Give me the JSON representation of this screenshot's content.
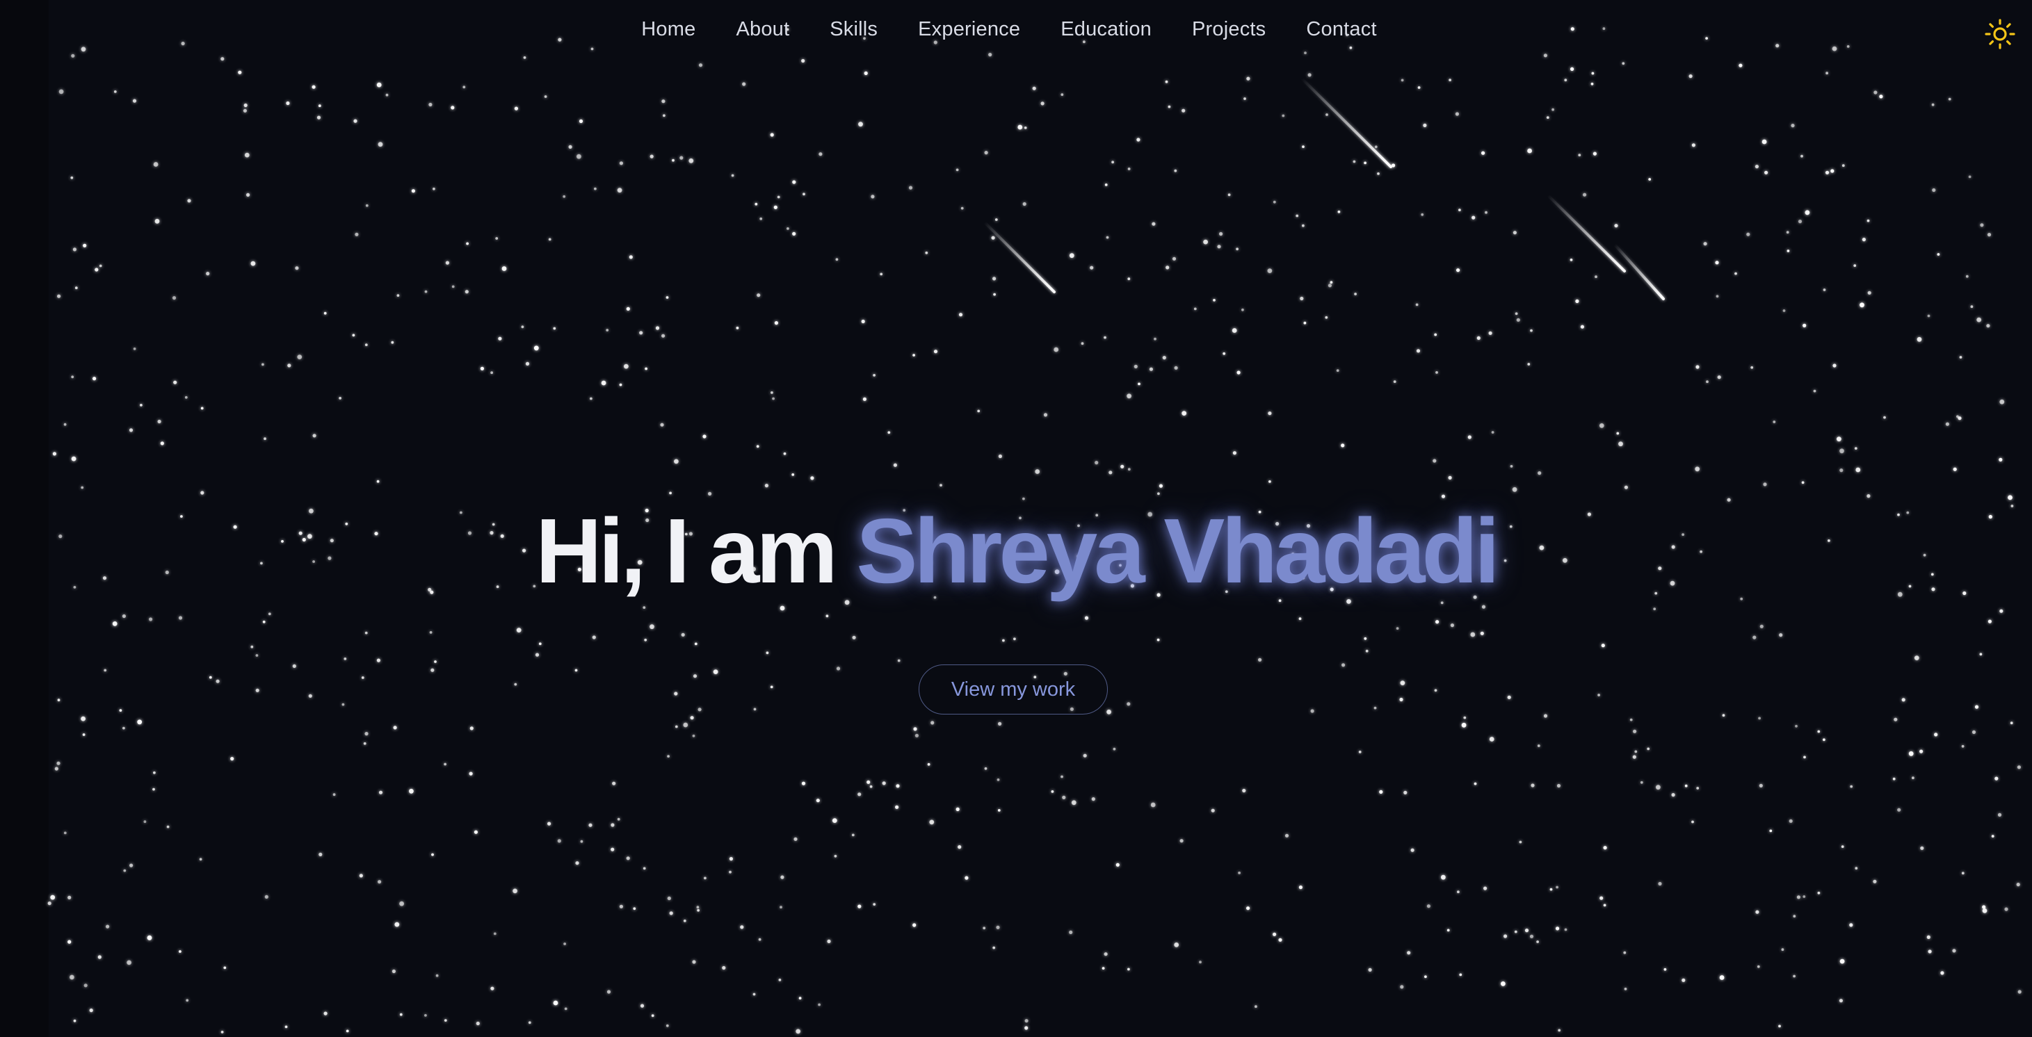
{
  "nav": {
    "items": [
      {
        "label": "Home"
      },
      {
        "label": "About"
      },
      {
        "label": "Skills"
      },
      {
        "label": "Experience"
      },
      {
        "label": "Education"
      },
      {
        "label": "Projects"
      },
      {
        "label": "Contact"
      }
    ]
  },
  "theme_toggle": {
    "icon": "sun-icon",
    "color": "#f5c518"
  },
  "hero": {
    "greeting": "Hi, I am ",
    "name": "Shreya Vhadadi",
    "cta_label": "View my work"
  },
  "colors": {
    "background": "#090b12",
    "accent": "#7b8acd",
    "nav_text": "#d9dce6",
    "star": "#ffffff"
  }
}
